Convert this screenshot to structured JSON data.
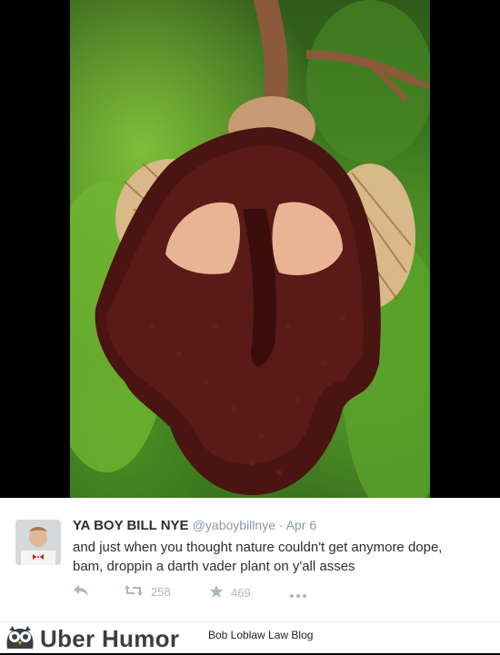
{
  "tweet": {
    "display_name": "YA BOY BILL NYE",
    "handle_date": "@yaboybillnye · Apr 6",
    "text": "and just when you thought nature couldn't get anymore dope, bam, droppin a darth vader plant on y'all asses",
    "retweet_count": "258",
    "favorite_count": "469"
  },
  "footer": {
    "brand": "Uber Humor",
    "tagline": "Bob Loblaw Law Blog"
  },
  "icons": {
    "reply": "reply-icon",
    "retweet": "retweet-icon",
    "favorite": "star-icon",
    "more": "more-icon",
    "logo": "owl-logo-icon"
  },
  "colors": {
    "text": "#292f33",
    "muted": "#8899a6",
    "action": "#aab8c2"
  }
}
